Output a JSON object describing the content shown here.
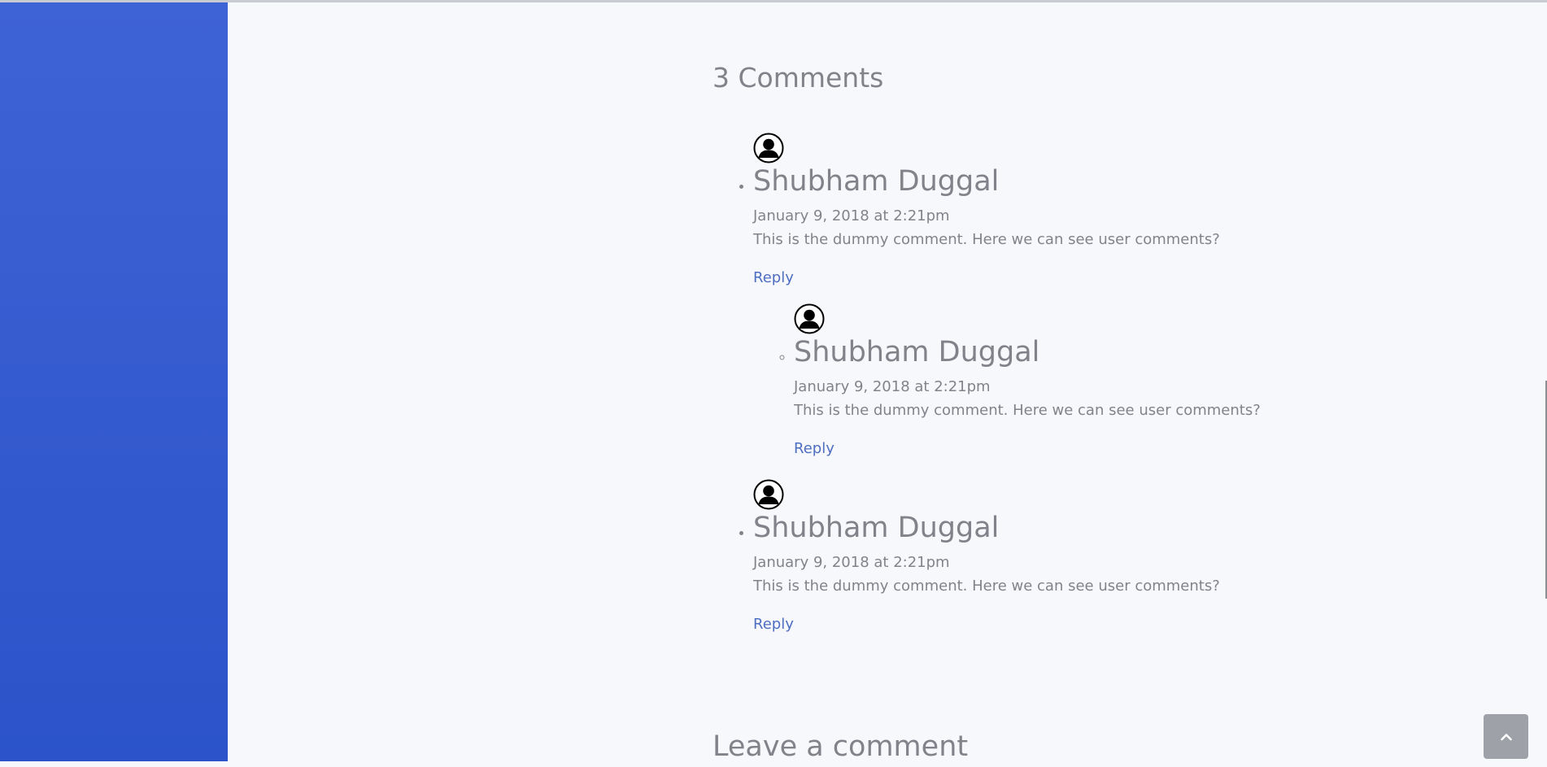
{
  "comments_section": {
    "title": "3 Comments",
    "comments": [
      {
        "author": "Shubham Duggal",
        "date": "January 9, 2018 at 2:21pm",
        "text": "This is the dummy comment. Here we can see user comments?",
        "reply_label": "Reply",
        "avatar_icon": "user-silhouette-icon",
        "children": [
          {
            "author": "Shubham Duggal",
            "date": "January 9, 2018 at 2:21pm",
            "text": "This is the dummy comment. Here we can see user comments?",
            "reply_label": "Reply",
            "avatar_icon": "user-silhouette-icon"
          }
        ]
      },
      {
        "author": "Shubham Duggal",
        "date": "January 9, 2018 at 2:21pm",
        "text": "This is the dummy comment. Here we can see user comments?",
        "reply_label": "Reply",
        "avatar_icon": "user-silhouette-icon"
      }
    ]
  },
  "leave_comment": {
    "title": "Leave a comment"
  },
  "scroll_top": {
    "icon": "chevron-up-icon"
  },
  "colors": {
    "sidebar_top": "#3e63d6",
    "sidebar_bottom": "#2c53c9",
    "background": "#f7f8fc",
    "text": "#82838a",
    "link": "#4e6ec2",
    "scroll_button": "#9ea1a8"
  }
}
